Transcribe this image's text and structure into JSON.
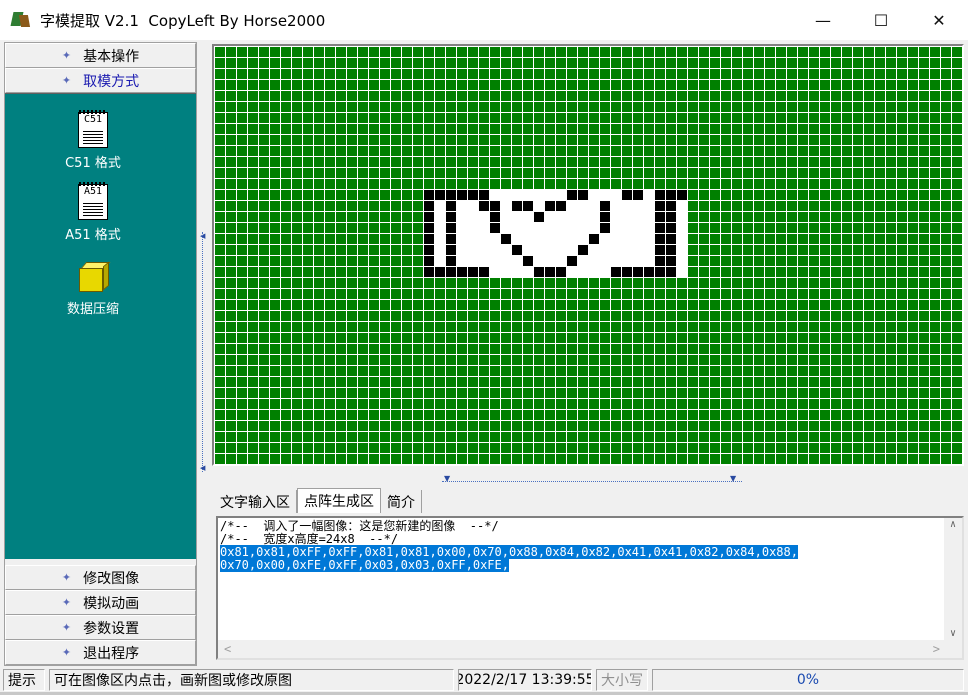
{
  "window": {
    "title": "字模提取 V2.1  CopyLeft By Horse2000",
    "minimize": "—",
    "maximize": "☐",
    "close": "✕"
  },
  "left_panel": {
    "top_menus": [
      {
        "label": "基本操作",
        "active": false
      },
      {
        "label": "取模方式",
        "active": true
      }
    ],
    "tools": [
      {
        "icon_text": "C51",
        "label": "C51 格式",
        "icon": "c51-document-icon"
      },
      {
        "icon_text": "A51",
        "label": "A51 格式",
        "icon": "a51-document-icon"
      },
      {
        "label": "数据压缩",
        "icon": "compress-cube-icon"
      }
    ],
    "bottom_menus": [
      {
        "label": "修改图像"
      },
      {
        "label": "模拟动画"
      },
      {
        "label": "参数设置"
      },
      {
        "label": "退出程序"
      }
    ]
  },
  "canvas": {
    "grid_color": "#ffffff",
    "background_color": "#008000",
    "pixel_on_color": "#000000",
    "image_bg_color": "#ffffff",
    "columns": 24,
    "rows": 8,
    "bitmap": [
      "111111000000011000110111",
      "101001101101100010000110",
      "101000100010000010000110",
      "101000100000000010000110",
      "101000010000000100000110",
      "101000001000001000000110",
      "101000000100010000000110",
      "111111000011100001111110"
    ]
  },
  "tabs": [
    {
      "label": "文字输入区",
      "active": false
    },
    {
      "label": "点阵生成区",
      "active": true
    },
    {
      "label": "简介",
      "active": false
    }
  ],
  "output": {
    "lines": [
      "/*--  调入了一幅图像：这是您新建的图像  --*/",
      "/*--  宽度x高度=24x8  --*/"
    ],
    "selected_lines": [
      "0x81,0x81,0xFF,0xFF,0x81,0x81,0x00,0x70,0x88,0x84,0x82,0x41,0x41,0x82,0x84,0x88,",
      "0x70,0x00,0xFE,0xFF,0x03,0x03,0xFF,0xFE,"
    ]
  },
  "status": {
    "hint_label": "提示",
    "hint_text": "可在图像区内点击，画新图或修改原图",
    "datetime": "2022/2/17 13:39:55",
    "caps": "大小写",
    "progress": "0%"
  }
}
